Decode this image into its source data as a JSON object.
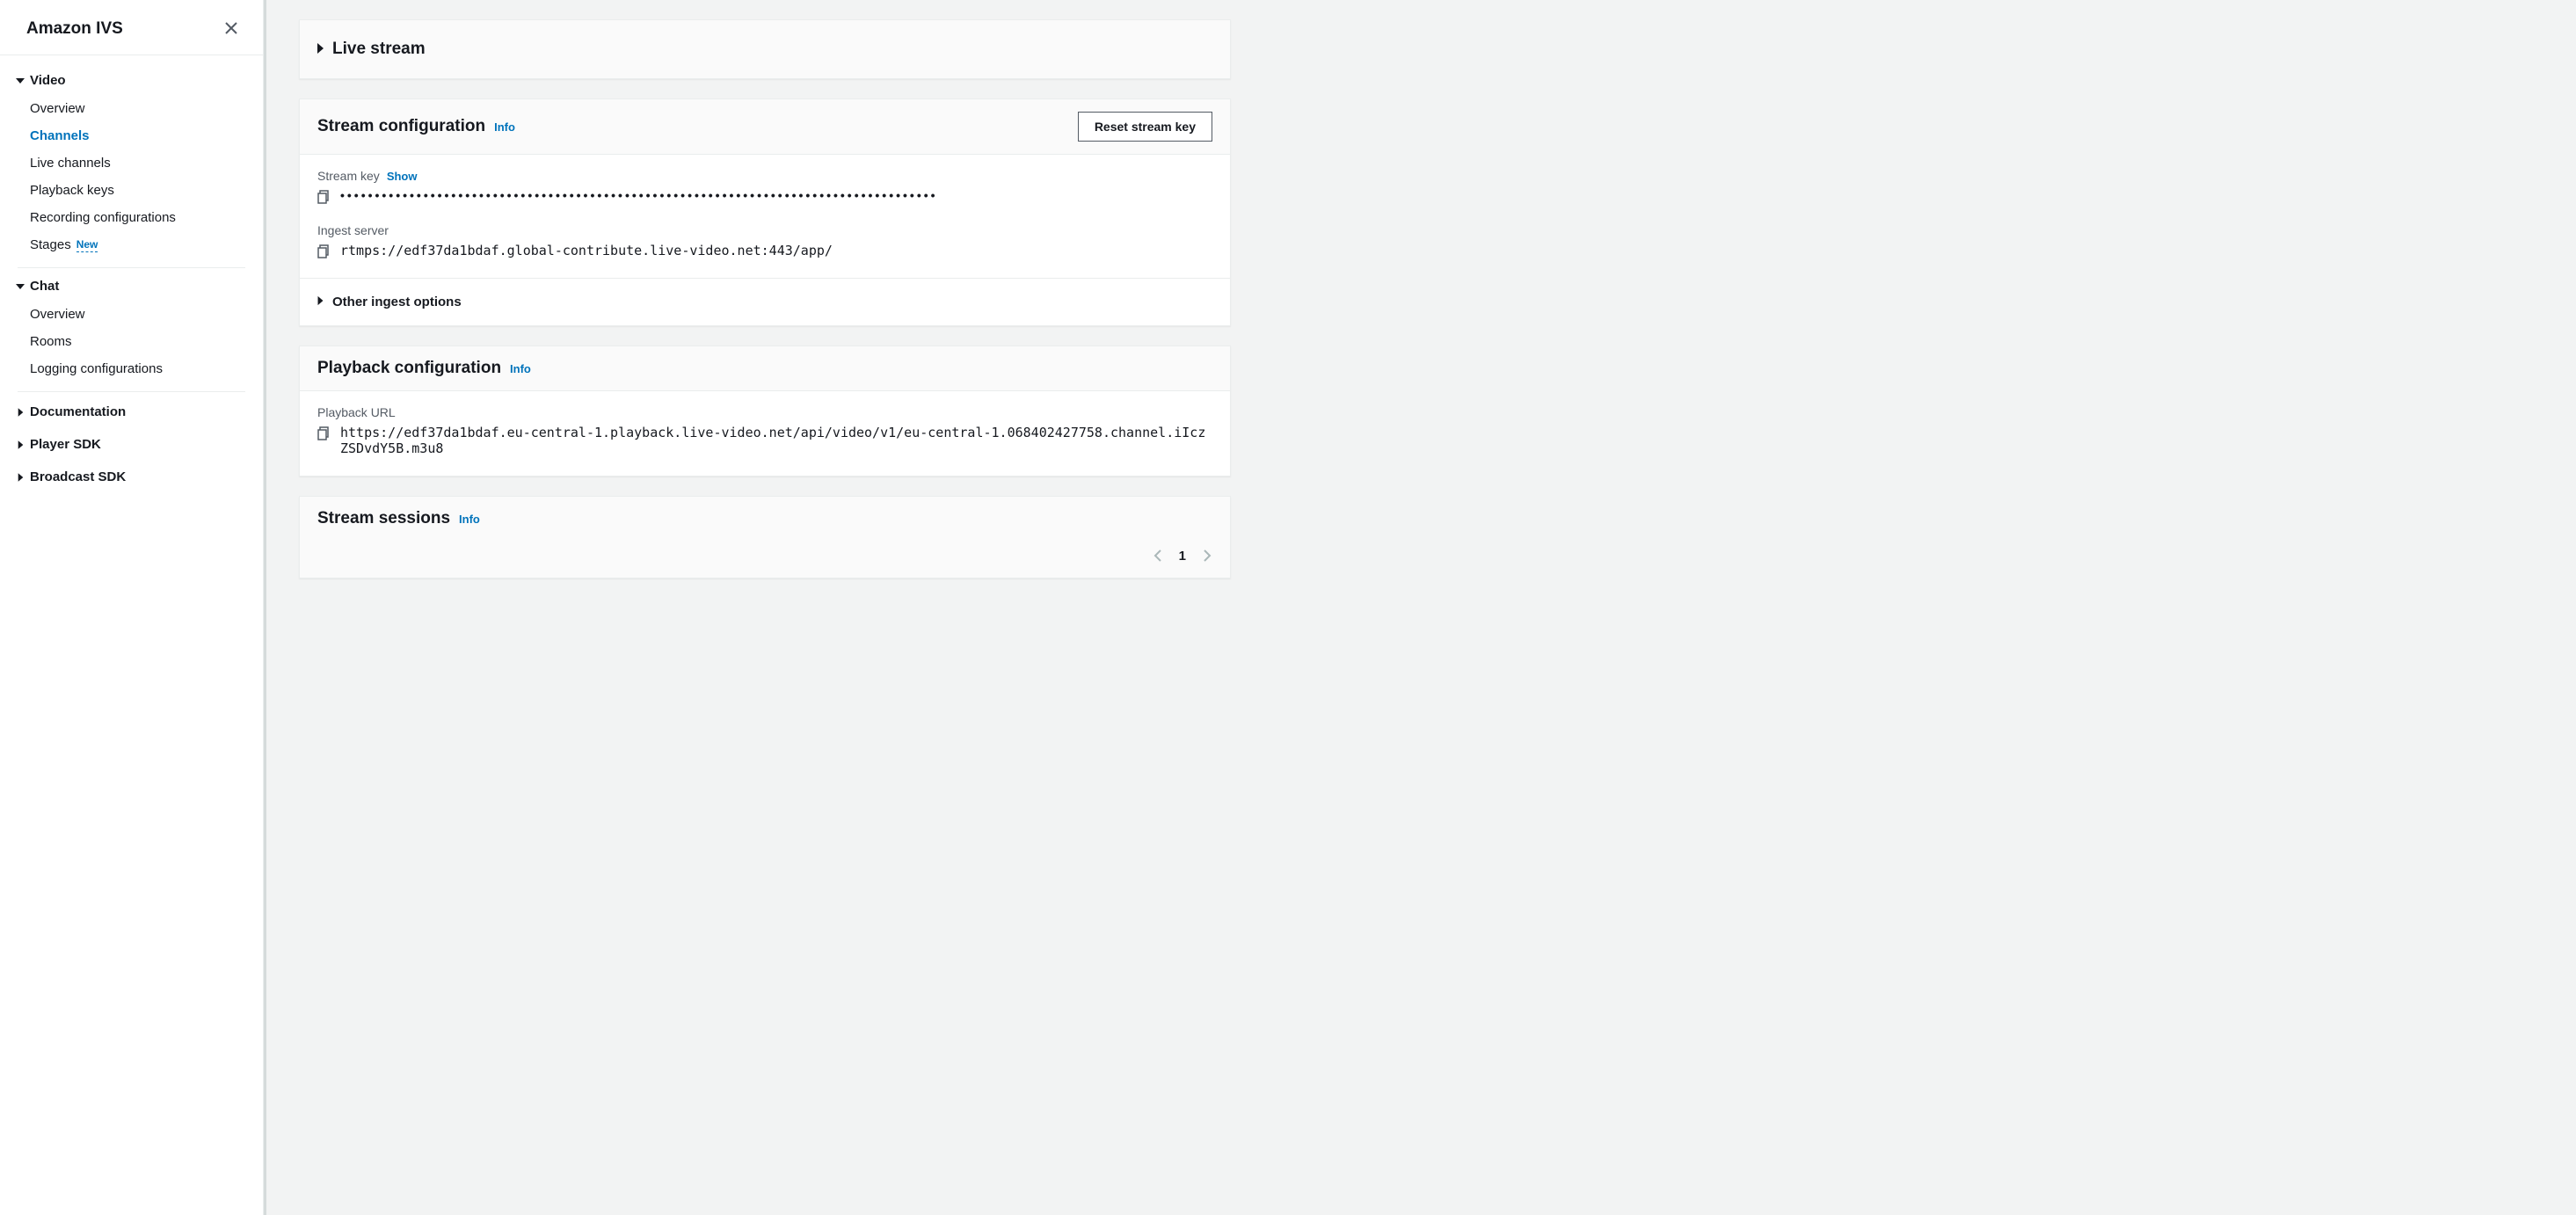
{
  "sidebar": {
    "title": "Amazon IVS",
    "groups": [
      {
        "label": "Video",
        "expanded": true,
        "items": [
          {
            "label": "Overview",
            "active": false
          },
          {
            "label": "Channels",
            "active": true
          },
          {
            "label": "Live channels",
            "active": false
          },
          {
            "label": "Playback keys",
            "active": false
          },
          {
            "label": "Recording configurations",
            "active": false
          },
          {
            "label": "Stages",
            "active": false,
            "badge": "New"
          }
        ]
      },
      {
        "label": "Chat",
        "expanded": true,
        "items": [
          {
            "label": "Overview",
            "active": false
          },
          {
            "label": "Rooms",
            "active": false
          },
          {
            "label": "Logging configurations",
            "active": false
          }
        ]
      }
    ],
    "collapsed": [
      "Documentation",
      "Player SDK",
      "Broadcast SDK"
    ]
  },
  "main": {
    "live_stream": {
      "title": "Live stream"
    },
    "stream_config": {
      "title": "Stream configuration",
      "info": "Info",
      "reset_button": "Reset stream key",
      "stream_key_label": "Stream key",
      "show_label": "Show",
      "stream_key_masked": "••••••••••••••••••••••••••••••••••••••••••••••••••••••••••••••••••••••••••••••••••••••",
      "ingest_label": "Ingest server",
      "ingest_value": "rtmps://edf37da1bdaf.global-contribute.live-video.net:443/app/",
      "other_ingest": "Other ingest options"
    },
    "playback_config": {
      "title": "Playback configuration",
      "info": "Info",
      "url_label": "Playback URL",
      "url_value": "https://edf37da1bdaf.eu-central-1.playback.live-video.net/api/video/v1/eu-central-1.068402427758.channel.iIczZSDvdY5B.m3u8"
    },
    "stream_sessions": {
      "title": "Stream sessions",
      "info": "Info",
      "page": "1"
    }
  }
}
